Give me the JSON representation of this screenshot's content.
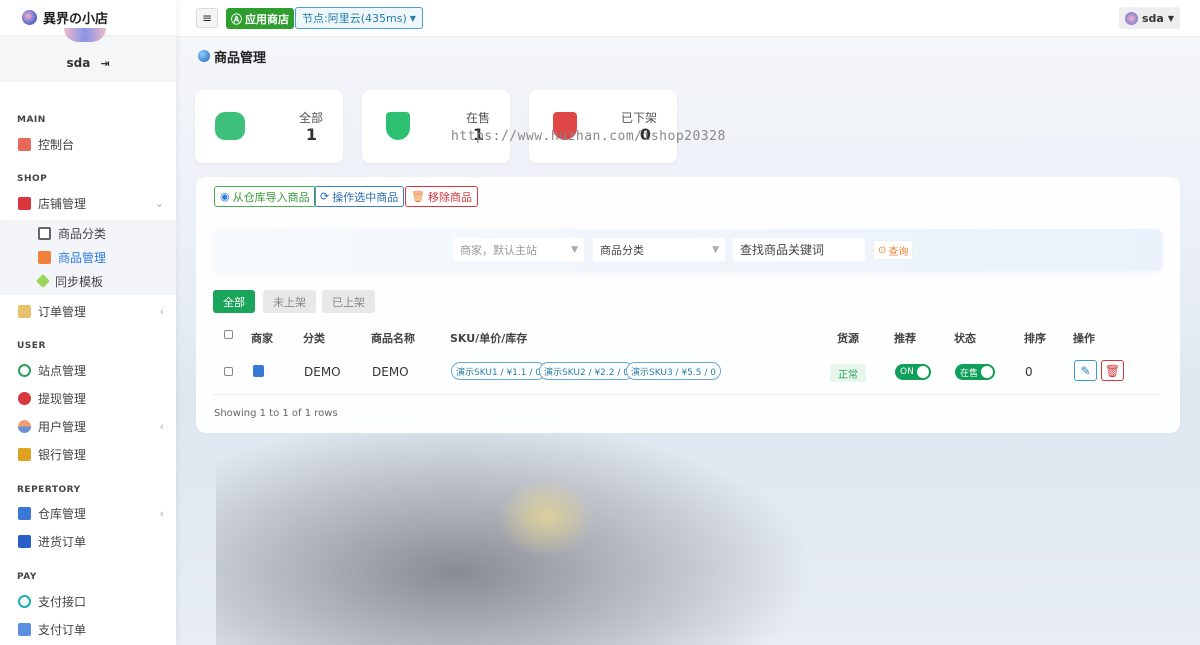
{
  "brand": {
    "title": "異界の小店"
  },
  "user": {
    "name": "sda"
  },
  "sidebar": {
    "sections": [
      "MAIN",
      "SHOP",
      "USER",
      "REPERTORY",
      "PAY"
    ],
    "items": [
      {
        "label": "控制台"
      },
      {
        "label": "店铺管理"
      },
      {
        "label": "商品分类"
      },
      {
        "label": "商品管理"
      },
      {
        "label": "同步模板"
      },
      {
        "label": "订单管理"
      },
      {
        "label": "站点管理"
      },
      {
        "label": "提现管理"
      },
      {
        "label": "用户管理"
      },
      {
        "label": "银行管理"
      },
      {
        "label": "仓库管理"
      },
      {
        "label": "进货订单"
      },
      {
        "label": "支付接口"
      },
      {
        "label": "支付订单"
      }
    ]
  },
  "topbar": {
    "app_store": "应用商店",
    "node": "节点:阿里云(435ms)",
    "user": "sda"
  },
  "page": {
    "title": "商品管理"
  },
  "stats": [
    {
      "label": "全部",
      "value": "1"
    },
    {
      "label": "在售",
      "value": "1"
    },
    {
      "label": "已下架",
      "value": "0"
    }
  ],
  "watermark": "https://www.huzhan.com/ishop20328",
  "toolbar": {
    "import": "从仓库导入商品",
    "batch": "操作选中商品",
    "remove": "移除商品"
  },
  "search": {
    "merchant": "商家，默认主站",
    "category": "商品分类",
    "keyword": "查找商品关键词",
    "query": "查询"
  },
  "tabs": [
    "全部",
    "未上架",
    "已上架"
  ],
  "table": {
    "headers": [
      "商家",
      "分类",
      "商品名称",
      "SKU/单价/库存",
      "货源",
      "推荐",
      "状态",
      "排序",
      "操作"
    ],
    "rows": [
      {
        "category": "DEMO",
        "name": "DEMO",
        "skus": [
          "演示SKU1 / ¥1.1 / 0",
          "演示SKU2 / ¥2.2 / 0",
          "演示SKU3 / ¥5.5 / 0"
        ],
        "source": "正常",
        "recommend": "ON",
        "status": "在售",
        "sort": "0"
      }
    ],
    "footer": "Showing 1 to 1 of 1 rows"
  },
  "colors": {
    "primary": "#0f9f5a",
    "accent": "#2a7de1",
    "danger": "#d9363e"
  }
}
